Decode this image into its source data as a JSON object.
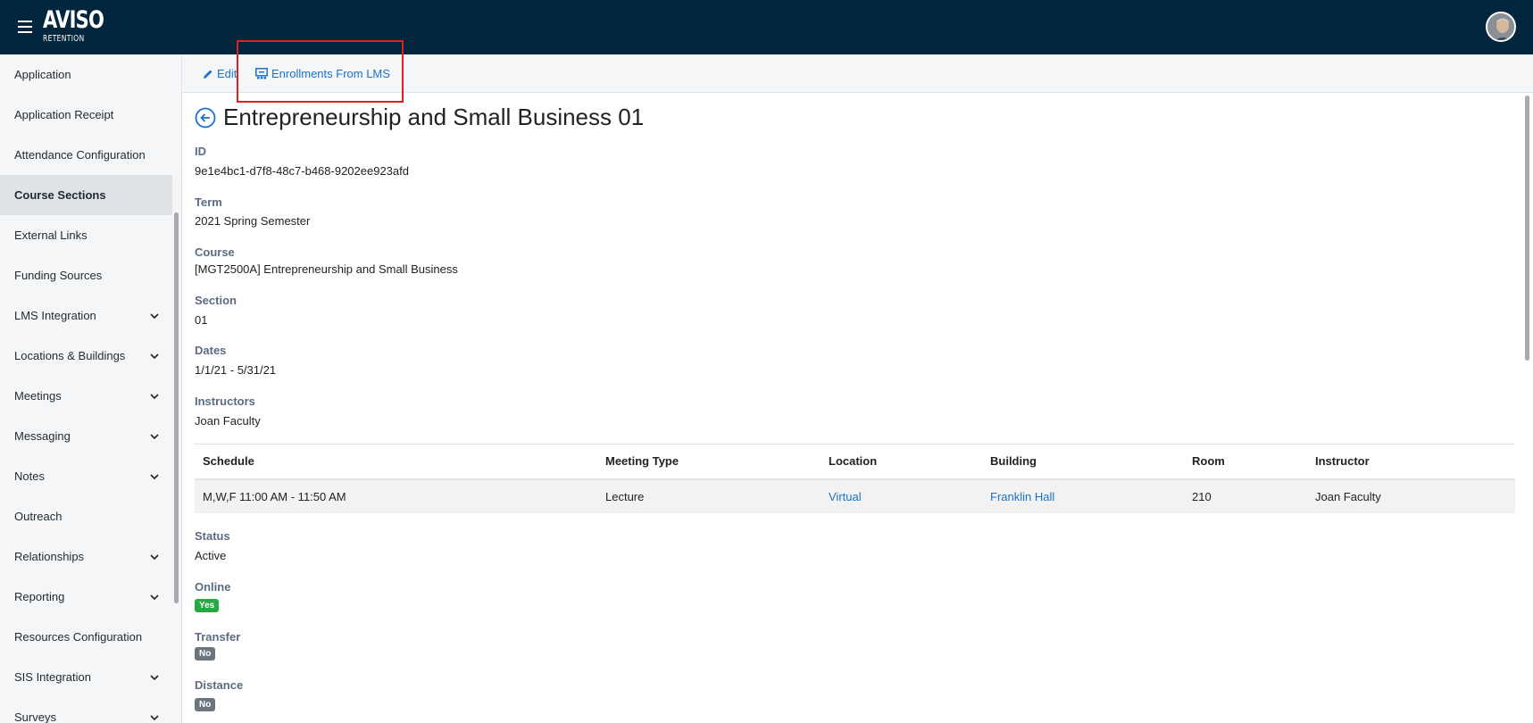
{
  "app": {
    "logo_main": "AVISO",
    "logo_sub": "RETENTION"
  },
  "sidebar": {
    "items": [
      {
        "label": "Application",
        "expandable": false
      },
      {
        "label": "Application Receipt",
        "expandable": false
      },
      {
        "label": "Attendance Configuration",
        "expandable": false
      },
      {
        "label": "Course Sections",
        "expandable": false,
        "active": true
      },
      {
        "label": "External Links",
        "expandable": false
      },
      {
        "label": "Funding Sources",
        "expandable": false
      },
      {
        "label": "LMS Integration",
        "expandable": true
      },
      {
        "label": "Locations & Buildings",
        "expandable": true
      },
      {
        "label": "Meetings",
        "expandable": true
      },
      {
        "label": "Messaging",
        "expandable": true
      },
      {
        "label": "Notes",
        "expandable": true
      },
      {
        "label": "Outreach",
        "expandable": false
      },
      {
        "label": "Relationships",
        "expandable": true
      },
      {
        "label": "Reporting",
        "expandable": true
      },
      {
        "label": "Resources Configuration",
        "expandable": false
      },
      {
        "label": "SIS Integration",
        "expandable": true
      },
      {
        "label": "Surveys",
        "expandable": true
      }
    ]
  },
  "toolbar": {
    "edit_label": "Edit",
    "enrollments_label": "Enrollments From LMS"
  },
  "page": {
    "title": "Entrepreneurship and Small Business 01",
    "fields": {
      "id": {
        "label": "ID",
        "value": "9e1e4bc1-d7f8-48c7-b468-9202ee923afd"
      },
      "term": {
        "label": "Term",
        "value": "2021 Spring Semester"
      },
      "course": {
        "label": "Course",
        "value": "[MGT2500A] Entrepreneurship and Small Business"
      },
      "section": {
        "label": "Section",
        "value": "01"
      },
      "dates": {
        "label": "Dates",
        "value": "1/1/21 - 5/31/21"
      },
      "instructors": {
        "label": "Instructors",
        "value": "Joan Faculty"
      },
      "status": {
        "label": "Status",
        "value": "Active"
      },
      "online": {
        "label": "Online",
        "value": "Yes"
      },
      "transfer": {
        "label": "Transfer",
        "value": "No"
      },
      "distance": {
        "label": "Distance",
        "value": "No"
      }
    },
    "schedule": {
      "headers": [
        "Schedule",
        "Meeting Type",
        "Location",
        "Building",
        "Room",
        "Instructor"
      ],
      "rows": [
        [
          "M,W,F 11:00 AM - 11:50 AM",
          "Lecture",
          "Virtual",
          "Franklin Hall",
          "210",
          "Joan Faculty"
        ]
      ]
    }
  },
  "colors": {
    "topbar": "#03263f",
    "link": "#1a73c8",
    "label": "#5b6b82",
    "badge_yes": "#28a745",
    "badge_no": "#6c757d",
    "highlight": "#e02020"
  }
}
